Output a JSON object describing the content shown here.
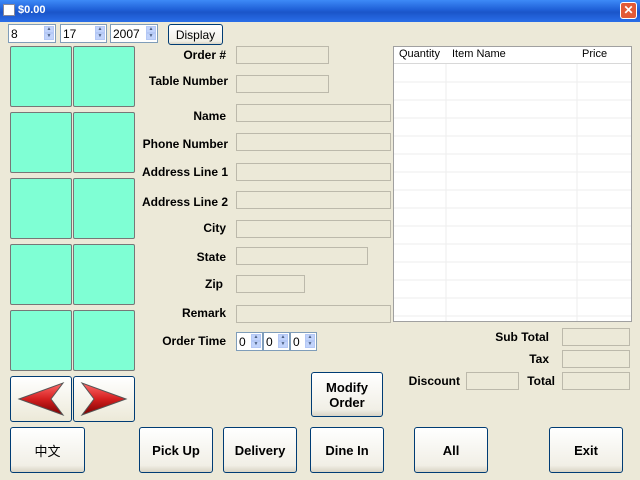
{
  "window": {
    "title": "$0.00",
    "close_glyph": "✕"
  },
  "date": {
    "month": "8",
    "day": "17",
    "year": "2007",
    "display_label": "Display"
  },
  "form": {
    "order_no_label": "Order #",
    "table_number_label": "Table Number",
    "name_label": "Name",
    "phone_label": "Phone Number",
    "address1_label": "Address Line 1",
    "address2_label": "Address Line 2",
    "city_label": "City",
    "state_label": "State",
    "zip_label": "Zip",
    "remark_label": "Remark",
    "order_time_label": "Order Time",
    "order_time": {
      "hour": "0",
      "minute": "0",
      "second": "0"
    }
  },
  "order_list": {
    "columns": [
      "Quantity",
      "Item Name",
      "Price"
    ]
  },
  "totals": {
    "subtotal_label": "Sub Total",
    "tax_label": "Tax",
    "discount_label": "Discount",
    "total_label": "Total"
  },
  "buttons": {
    "modify_order": "Modify Order",
    "chinese": "中文",
    "pick_up": "Pick Up",
    "delivery": "Delivery",
    "dine_in": "Dine In",
    "all": "All",
    "exit": "Exit"
  },
  "colors": {
    "tile": "#7fffd4",
    "arrow": "#d42020"
  },
  "icons": {
    "prev": "left-arrow-icon",
    "next": "right-arrow-icon"
  }
}
